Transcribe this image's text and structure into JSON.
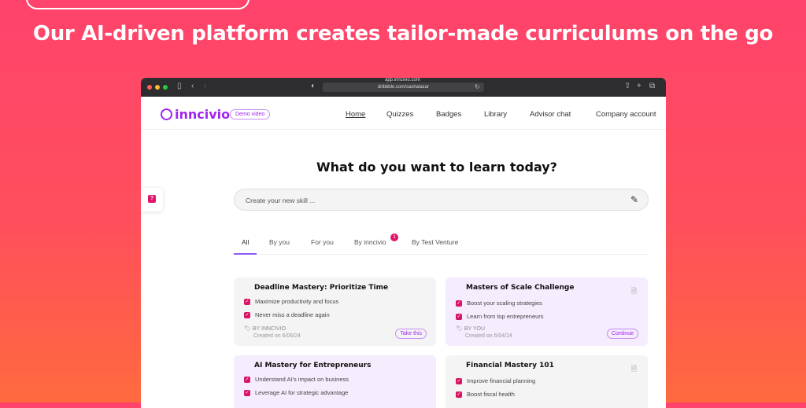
{
  "headline": "Our AI-driven platform creates tailor-made curriculums on the go",
  "browser": {
    "url_title": "app.inncivio.com",
    "url": "dribbble.com/sashalazar"
  },
  "nav": {
    "logo": "inncivio",
    "demo": "Demo video",
    "items": [
      "Home",
      "Quizzes",
      "Badges",
      "Library",
      "Advisor chat",
      "Company account"
    ]
  },
  "main": {
    "question": "What do you want to learn today?",
    "search_placeholder": "Create your new skill ...",
    "quiz_badge": "?",
    "tabs": [
      "All",
      "By you",
      "For you",
      "By inncivio",
      "By Test Venture"
    ],
    "tab_badge": "1"
  },
  "cards": [
    {
      "title": "Deadline Mastery: Prioritize Time",
      "items": [
        "Maximize productivity and focus",
        "Never miss a deadline again"
      ],
      "by": "BY INNCIVIO",
      "created": "Created on 6/06/24",
      "button": "Take this"
    },
    {
      "title": "Masters of Scale Challenge",
      "items": [
        "Boost your scaling strategies",
        "Learn from top entrepreneurs"
      ],
      "by": "BY YOU",
      "created": "Created on 6/04/24",
      "button": "Continue"
    },
    {
      "title": "AI Mastery for Entrepreneurs",
      "items": [
        "Understand AI's impact on business",
        "Leverage AI for strategic advantage"
      ]
    },
    {
      "title": "Financial Mastery 101",
      "items": [
        "Improve financial planning",
        "Boost fiscal health"
      ]
    }
  ],
  "colors": {
    "accent": "#a025f0",
    "pink": "#d81565"
  }
}
